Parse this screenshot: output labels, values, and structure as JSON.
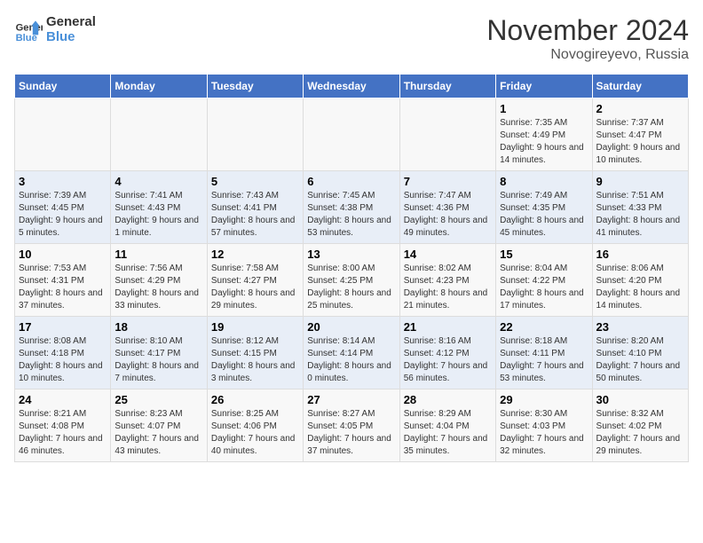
{
  "logo": {
    "text_general": "General",
    "text_blue": "Blue"
  },
  "title": "November 2024",
  "location": "Novogireyevo, Russia",
  "days_of_week": [
    "Sunday",
    "Monday",
    "Tuesday",
    "Wednesday",
    "Thursday",
    "Friday",
    "Saturday"
  ],
  "weeks": [
    [
      {
        "day": "",
        "info": ""
      },
      {
        "day": "",
        "info": ""
      },
      {
        "day": "",
        "info": ""
      },
      {
        "day": "",
        "info": ""
      },
      {
        "day": "",
        "info": ""
      },
      {
        "day": "1",
        "info": "Sunrise: 7:35 AM\nSunset: 4:49 PM\nDaylight: 9 hours and 14 minutes."
      },
      {
        "day": "2",
        "info": "Sunrise: 7:37 AM\nSunset: 4:47 PM\nDaylight: 9 hours and 10 minutes."
      }
    ],
    [
      {
        "day": "3",
        "info": "Sunrise: 7:39 AM\nSunset: 4:45 PM\nDaylight: 9 hours and 5 minutes."
      },
      {
        "day": "4",
        "info": "Sunrise: 7:41 AM\nSunset: 4:43 PM\nDaylight: 9 hours and 1 minute."
      },
      {
        "day": "5",
        "info": "Sunrise: 7:43 AM\nSunset: 4:41 PM\nDaylight: 8 hours and 57 minutes."
      },
      {
        "day": "6",
        "info": "Sunrise: 7:45 AM\nSunset: 4:38 PM\nDaylight: 8 hours and 53 minutes."
      },
      {
        "day": "7",
        "info": "Sunrise: 7:47 AM\nSunset: 4:36 PM\nDaylight: 8 hours and 49 minutes."
      },
      {
        "day": "8",
        "info": "Sunrise: 7:49 AM\nSunset: 4:35 PM\nDaylight: 8 hours and 45 minutes."
      },
      {
        "day": "9",
        "info": "Sunrise: 7:51 AM\nSunset: 4:33 PM\nDaylight: 8 hours and 41 minutes."
      }
    ],
    [
      {
        "day": "10",
        "info": "Sunrise: 7:53 AM\nSunset: 4:31 PM\nDaylight: 8 hours and 37 minutes."
      },
      {
        "day": "11",
        "info": "Sunrise: 7:56 AM\nSunset: 4:29 PM\nDaylight: 8 hours and 33 minutes."
      },
      {
        "day": "12",
        "info": "Sunrise: 7:58 AM\nSunset: 4:27 PM\nDaylight: 8 hours and 29 minutes."
      },
      {
        "day": "13",
        "info": "Sunrise: 8:00 AM\nSunset: 4:25 PM\nDaylight: 8 hours and 25 minutes."
      },
      {
        "day": "14",
        "info": "Sunrise: 8:02 AM\nSunset: 4:23 PM\nDaylight: 8 hours and 21 minutes."
      },
      {
        "day": "15",
        "info": "Sunrise: 8:04 AM\nSunset: 4:22 PM\nDaylight: 8 hours and 17 minutes."
      },
      {
        "day": "16",
        "info": "Sunrise: 8:06 AM\nSunset: 4:20 PM\nDaylight: 8 hours and 14 minutes."
      }
    ],
    [
      {
        "day": "17",
        "info": "Sunrise: 8:08 AM\nSunset: 4:18 PM\nDaylight: 8 hours and 10 minutes."
      },
      {
        "day": "18",
        "info": "Sunrise: 8:10 AM\nSunset: 4:17 PM\nDaylight: 8 hours and 7 minutes."
      },
      {
        "day": "19",
        "info": "Sunrise: 8:12 AM\nSunset: 4:15 PM\nDaylight: 8 hours and 3 minutes."
      },
      {
        "day": "20",
        "info": "Sunrise: 8:14 AM\nSunset: 4:14 PM\nDaylight: 8 hours and 0 minutes."
      },
      {
        "day": "21",
        "info": "Sunrise: 8:16 AM\nSunset: 4:12 PM\nDaylight: 7 hours and 56 minutes."
      },
      {
        "day": "22",
        "info": "Sunrise: 8:18 AM\nSunset: 4:11 PM\nDaylight: 7 hours and 53 minutes."
      },
      {
        "day": "23",
        "info": "Sunrise: 8:20 AM\nSunset: 4:10 PM\nDaylight: 7 hours and 50 minutes."
      }
    ],
    [
      {
        "day": "24",
        "info": "Sunrise: 8:21 AM\nSunset: 4:08 PM\nDaylight: 7 hours and 46 minutes."
      },
      {
        "day": "25",
        "info": "Sunrise: 8:23 AM\nSunset: 4:07 PM\nDaylight: 7 hours and 43 minutes."
      },
      {
        "day": "26",
        "info": "Sunrise: 8:25 AM\nSunset: 4:06 PM\nDaylight: 7 hours and 40 minutes."
      },
      {
        "day": "27",
        "info": "Sunrise: 8:27 AM\nSunset: 4:05 PM\nDaylight: 7 hours and 37 minutes."
      },
      {
        "day": "28",
        "info": "Sunrise: 8:29 AM\nSunset: 4:04 PM\nDaylight: 7 hours and 35 minutes."
      },
      {
        "day": "29",
        "info": "Sunrise: 8:30 AM\nSunset: 4:03 PM\nDaylight: 7 hours and 32 minutes."
      },
      {
        "day": "30",
        "info": "Sunrise: 8:32 AM\nSunset: 4:02 PM\nDaylight: 7 hours and 29 minutes."
      }
    ]
  ]
}
